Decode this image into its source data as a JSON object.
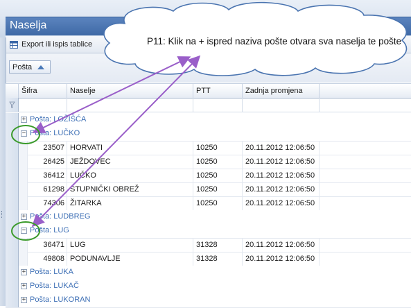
{
  "window": {
    "title": "Naselja"
  },
  "toolbar": {
    "export_label": "Export ili ispis tablice",
    "export_icon": "table-export-icon"
  },
  "group_area": {
    "chip_label": "Pošta"
  },
  "grid": {
    "columns": [
      "Šifra",
      "Naselje",
      "PTT",
      "Zadnja promjena"
    ],
    "filter_icon": "filter-icon",
    "rows": [
      {
        "type": "group",
        "expander": "+",
        "label": "Pošta: LOŽIŠĆA"
      },
      {
        "type": "group",
        "expander": "−",
        "label": "Pošta: LUČKO"
      },
      {
        "type": "data",
        "sifra": "23507",
        "naselje": "HORVATI",
        "ptt": "10250",
        "promjena": "20.11.2012 12:06:50"
      },
      {
        "type": "data",
        "sifra": "26425",
        "naselje": "JEŽDOVEC",
        "ptt": "10250",
        "promjena": "20.11.2012 12:06:50"
      },
      {
        "type": "data",
        "sifra": "36412",
        "naselje": "LUČKO",
        "ptt": "10250",
        "promjena": "20.11.2012 12:06:50"
      },
      {
        "type": "data",
        "sifra": "61298",
        "naselje": "STUPNIČKI OBREŽ",
        "ptt": "10250",
        "promjena": "20.11.2012 12:06:50"
      },
      {
        "type": "data",
        "sifra": "74306",
        "naselje": "ŽITARKA",
        "ptt": "10250",
        "promjena": "20.11.2012 12:06:50"
      },
      {
        "type": "group",
        "expander": "+",
        "label": "Pošta: LUDBREG"
      },
      {
        "type": "group",
        "expander": "−",
        "label": "Pošta: LUG"
      },
      {
        "type": "data",
        "sifra": "36471",
        "naselje": "LUG",
        "ptt": "31328",
        "promjena": "20.11.2012 12:06:50"
      },
      {
        "type": "data",
        "sifra": "49808",
        "naselje": "PODUNAVLJE",
        "ptt": "31328",
        "promjena": "20.11.2012 12:06:50"
      },
      {
        "type": "group",
        "expander": "+",
        "label": "Pošta: LUKA"
      },
      {
        "type": "group",
        "expander": "+",
        "label": "Pošta: LUKAČ"
      },
      {
        "type": "group",
        "expander": "+",
        "label": "Pošta: LUKORAN"
      }
    ]
  },
  "callout": {
    "text": "P11: Klik na + ispred naziva pošte otvara sva naselja te pošte"
  },
  "colors": {
    "accent": "#3f6aa6",
    "group_text": "#3d6fb5",
    "arrow": "#9a5fc9",
    "highlight": "#3a9a2a"
  }
}
